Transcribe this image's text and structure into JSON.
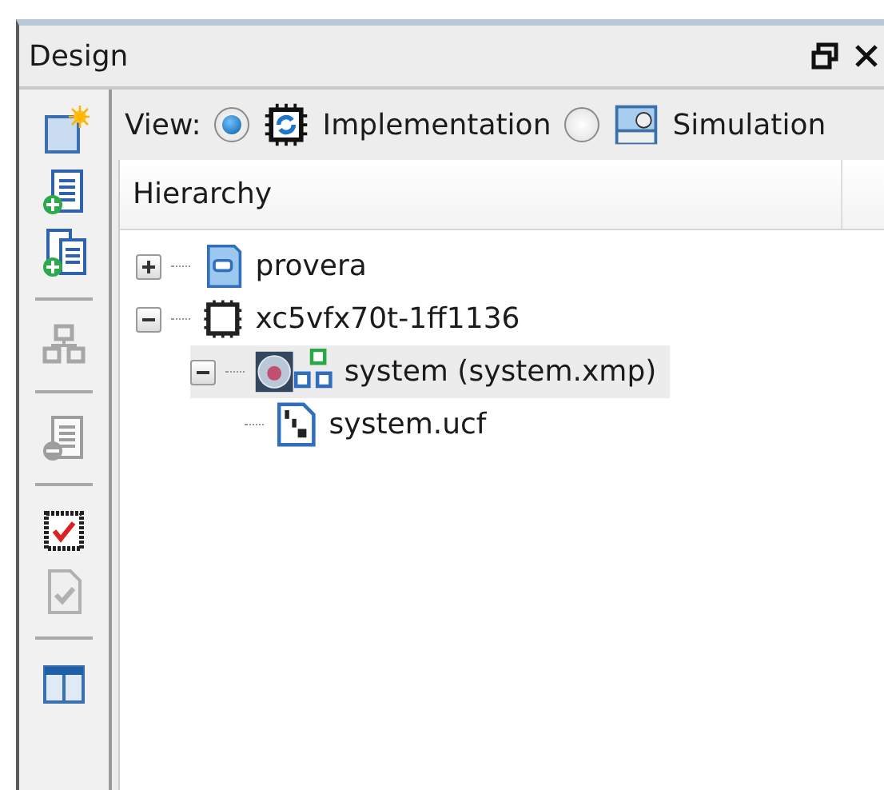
{
  "panel": {
    "title": "Design"
  },
  "toolbar": [
    {
      "kind": "new-source",
      "disabled": false
    },
    {
      "kind": "add-source",
      "disabled": false
    },
    {
      "kind": "add-copy",
      "disabled": false
    },
    {
      "kind": "separator"
    },
    {
      "kind": "cores",
      "disabled": true
    },
    {
      "kind": "separator"
    },
    {
      "kind": "remove",
      "disabled": true
    },
    {
      "kind": "separator"
    },
    {
      "kind": "check",
      "disabled": false
    },
    {
      "kind": "doc-check",
      "disabled": true
    },
    {
      "kind": "separator"
    },
    {
      "kind": "layout",
      "disabled": false
    }
  ],
  "view": {
    "label": "View:",
    "options": [
      {
        "label": "Implementation",
        "kind": "chip",
        "selected": true
      },
      {
        "label": "Simulation",
        "kind": "sim",
        "selected": false
      }
    ]
  },
  "hierarchy": {
    "header": "Hierarchy",
    "tree": [
      {
        "label": "provera",
        "kind": "project",
        "expanded": false,
        "selected": false
      },
      {
        "label": "xc5vfx70t-1ff1136",
        "kind": "device",
        "expanded": true,
        "selected": false,
        "children": [
          {
            "label": "system (system.xmp)",
            "kind": "system",
            "expanded": true,
            "selected": true,
            "children": [
              {
                "label": "system.ucf",
                "kind": "ucf",
                "selected": false
              }
            ]
          }
        ]
      }
    ]
  }
}
